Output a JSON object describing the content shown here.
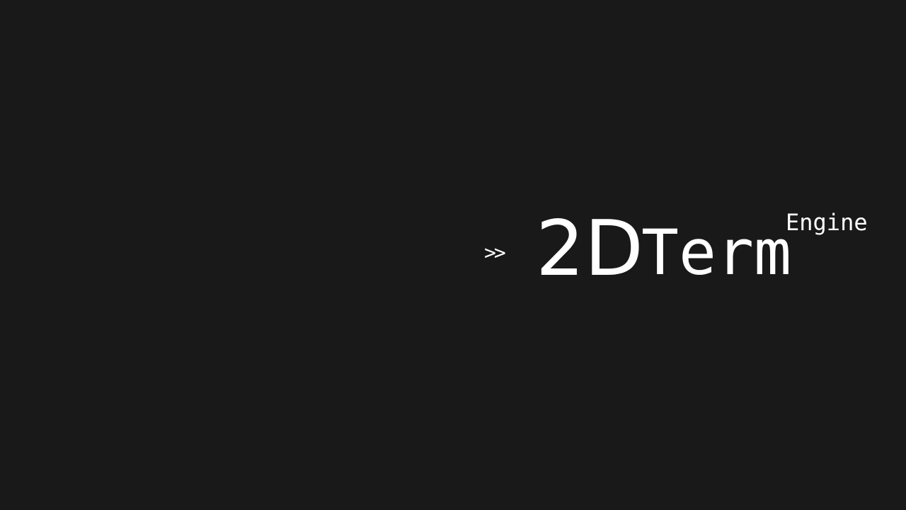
{
  "splash": {
    "prompt": ">>",
    "title_main": "2D",
    "title_term": "Term",
    "title_suffix": "Engine"
  },
  "colors": {
    "background": "#191919",
    "foreground": "#ffffff"
  }
}
